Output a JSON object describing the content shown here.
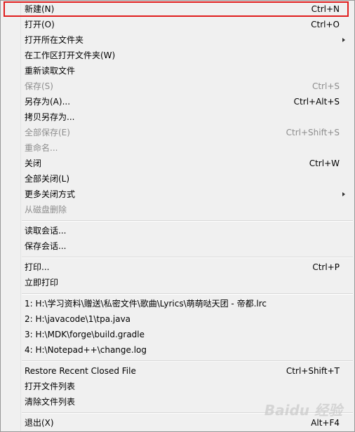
{
  "menu": {
    "items": [
      {
        "label": "新建(N)",
        "shortcut": "Ctrl+N"
      },
      {
        "label": "打开(O)",
        "shortcut": "Ctrl+O"
      },
      {
        "label": "打开所在文件夹",
        "shortcut": ""
      },
      {
        "label": "在工作区打开文件夹(W)",
        "shortcut": ""
      },
      {
        "label": "重新读取文件",
        "shortcut": ""
      },
      {
        "label": "保存(S)",
        "shortcut": "Ctrl+S"
      },
      {
        "label": "另存为(A)...",
        "shortcut": "Ctrl+Alt+S"
      },
      {
        "label": "拷贝另存为...",
        "shortcut": ""
      },
      {
        "label": "全部保存(E)",
        "shortcut": "Ctrl+Shift+S"
      },
      {
        "label": "重命名...",
        "shortcut": ""
      },
      {
        "label": "关闭",
        "shortcut": "Ctrl+W"
      },
      {
        "label": "全部关闭(L)",
        "shortcut": ""
      },
      {
        "label": "更多关闭方式",
        "shortcut": ""
      },
      {
        "label": "从磁盘删除",
        "shortcut": ""
      },
      {
        "label": "读取会话...",
        "shortcut": ""
      },
      {
        "label": "保存会话...",
        "shortcut": ""
      },
      {
        "label": "打印...",
        "shortcut": "Ctrl+P"
      },
      {
        "label": "立即打印",
        "shortcut": ""
      },
      {
        "label": "1: H:\\学习资料\\赠送\\私密文件\\歌曲\\Lyrics\\萌萌哒天团 - 帝都.lrc",
        "shortcut": ""
      },
      {
        "label": "2: H:\\javacode\\1\\tpa.java",
        "shortcut": ""
      },
      {
        "label": "3: H:\\MDK\\forge\\build.gradle",
        "shortcut": ""
      },
      {
        "label": "4: H:\\Notepad++\\change.log",
        "shortcut": ""
      },
      {
        "label": "Restore Recent Closed File",
        "shortcut": "Ctrl+Shift+T"
      },
      {
        "label": "打开文件列表",
        "shortcut": ""
      },
      {
        "label": "清除文件列表",
        "shortcut": ""
      },
      {
        "label": "退出(X)",
        "shortcut": "Alt+F4"
      }
    ]
  },
  "watermark": "Baidu 经验",
  "colors": {
    "highlight_border": "#e01e1e",
    "disabled_text": "#8d8d8d",
    "menu_background": "#f0f0f0"
  }
}
